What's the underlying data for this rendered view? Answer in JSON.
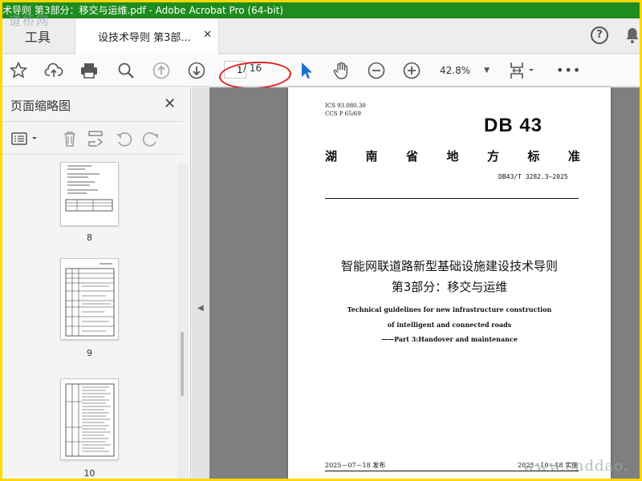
{
  "window": {
    "title": "术导则 第3部分：移交与运维.pdf - Adobe Acrobat Pro (64-bit)"
  },
  "tabs": {
    "tools_label": "工具",
    "doc_tab_label": "设技术导则 第3部...",
    "close_glyph": "✕",
    "help_glyph": "?"
  },
  "watermark": {
    "top_left": "道桥网",
    "bottom_right": "www.cnddao."
  },
  "toolbar": {
    "current_page": "1",
    "total_pages": "/ 16",
    "zoom": "42.8%",
    "more_glyph": "•••",
    "icons": [
      "star-icon",
      "cloud-upload-icon",
      "print-icon",
      "search-zoom-icon",
      "arrow-up-circle-icon",
      "arrow-down-circle-icon",
      "pointer-icon",
      "hand-icon",
      "zoom-out-icon",
      "zoom-in-icon",
      "fit-page-icon",
      "more-icon"
    ]
  },
  "panel": {
    "title": "页面缩略图",
    "close_glyph": "✕",
    "thumbnails": [
      {
        "label": "8"
      },
      {
        "label": "9"
      },
      {
        "label": "10"
      }
    ]
  },
  "document": {
    "ics": "ICS 93.080.30",
    "ccs": "CCS P 65/69",
    "db_logo": "DB 43",
    "province_chars": [
      "湖",
      "南",
      "省",
      "地",
      "方",
      "标",
      "准"
    ],
    "standard_number": "DB43/T 3282.3—2025",
    "title_line1": "智能网联道路新型基础设施建设技术导则",
    "title_line2": "第3部分：移交与运维",
    "english_line1": "Technical guidelines for new infrastructure construction",
    "english_line2": "of intelligent and connected roads",
    "english_line3": "——Part 3:Handover and maintenance",
    "issue_date": "2025－07－18 发布",
    "implement_date": "2025－10－18 实施"
  },
  "colors": {
    "titlebar_bg": "#1f8c1f",
    "frame": "#ffd800",
    "annotation_circle": "#e02020",
    "doc_bg": "#7f7f7f"
  }
}
